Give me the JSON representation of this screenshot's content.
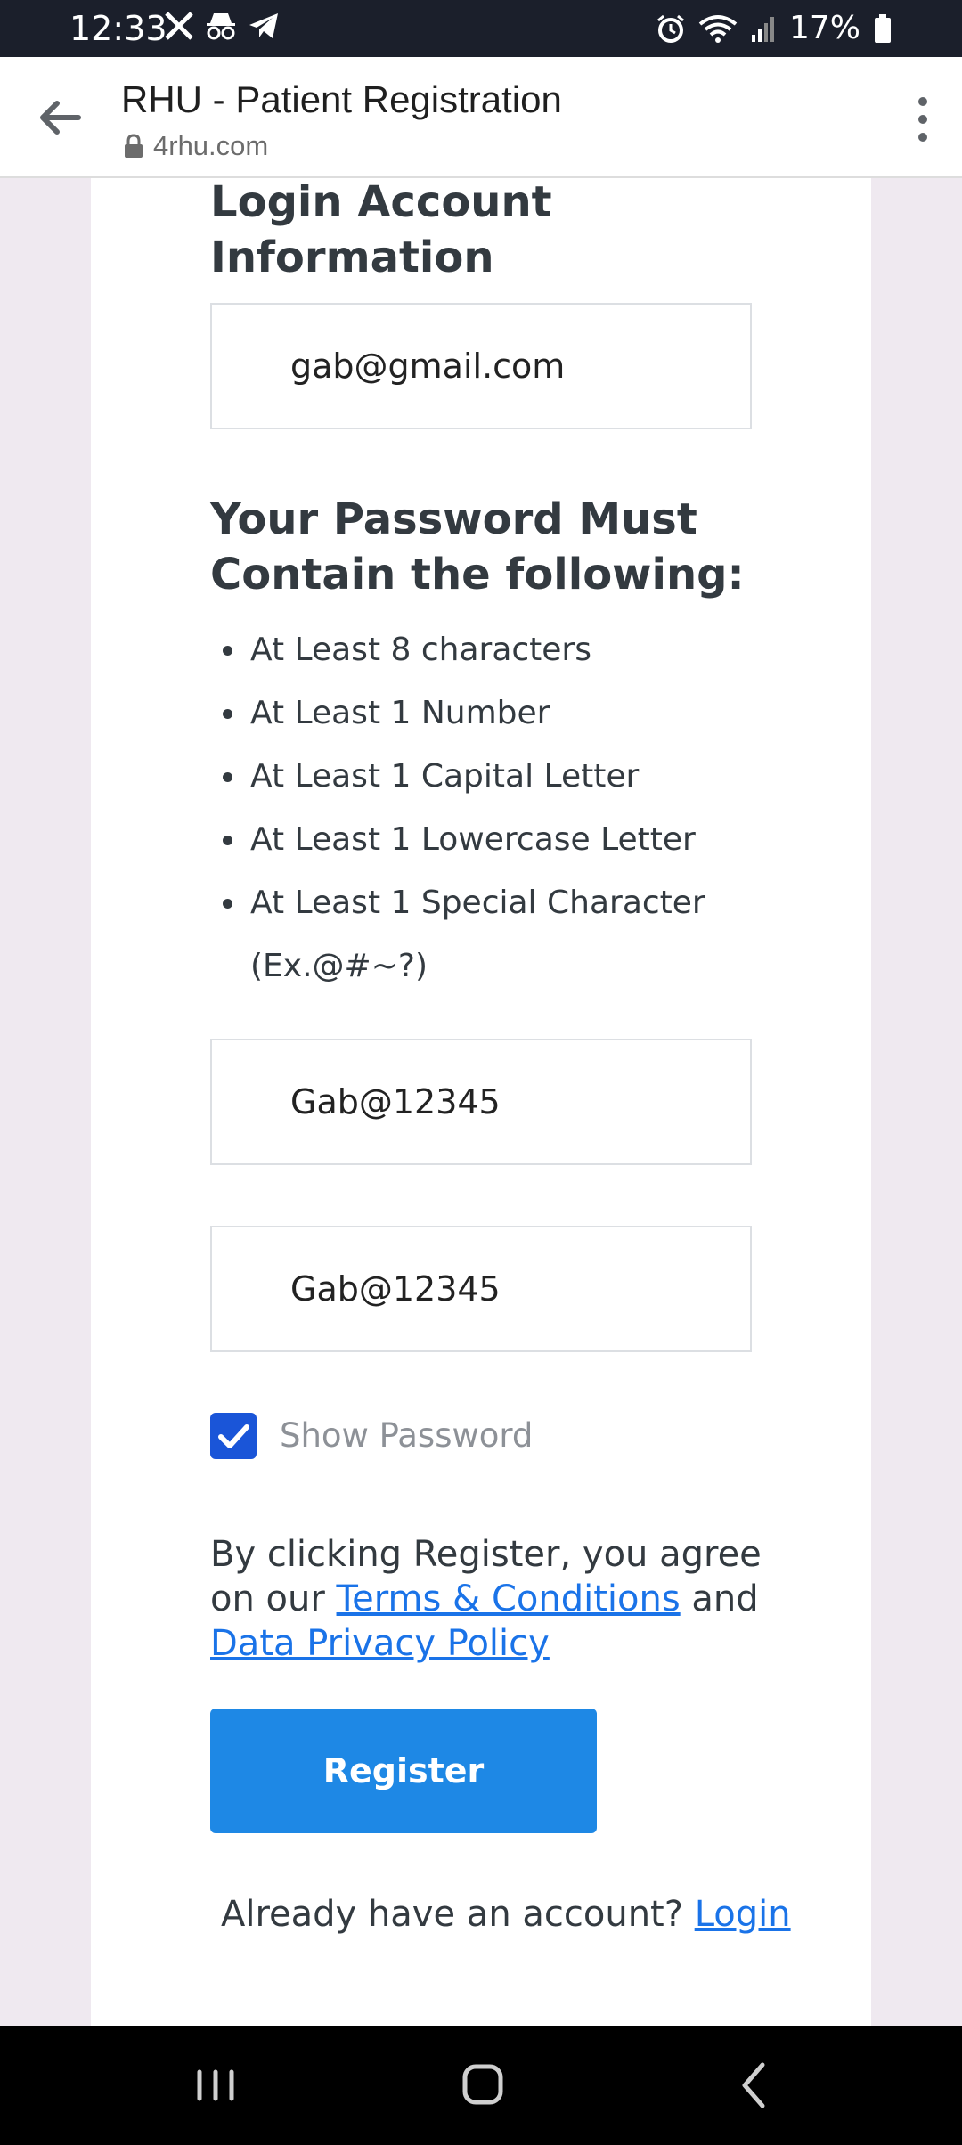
{
  "status_bar": {
    "time": "12:33",
    "battery": "17%",
    "left_icons": [
      "x-icon",
      "incognito-icon",
      "telegram-icon"
    ],
    "right_icons": [
      "alarm-icon",
      "wifi-icon",
      "signal-icon",
      "battery-icon"
    ]
  },
  "browser": {
    "title": "RHU - Patient Registration",
    "url": "4rhu.com"
  },
  "form": {
    "login_heading": "Login Account Information",
    "email_value": "gab@gmail.com",
    "password_heading": "Your Password Must Contain the following:",
    "rules": [
      "At Least 8 characters",
      "At Least 1 Number",
      "At Least 1 Capital Letter",
      "At Least 1 Lowercase Letter",
      "At Least 1 Special Character"
    ],
    "special_example": "(Ex.@#~?)",
    "password_value": "Gab@12345",
    "confirm_value": "Gab@12345",
    "show_password_label": "Show Password",
    "show_password_checked": true,
    "agree_prefix": "By clicking Register, you agree on our",
    "terms_link": "Terms & Conditions",
    "agree_and": "and",
    "privacy_link": "Data Privacy Policy",
    "register_label": "Register",
    "already_text": "Already have an account?",
    "login_link": "Login"
  },
  "colors": {
    "accent": "#1e88e5",
    "link": "#1a73e8",
    "checkbox": "#1a55d8"
  }
}
